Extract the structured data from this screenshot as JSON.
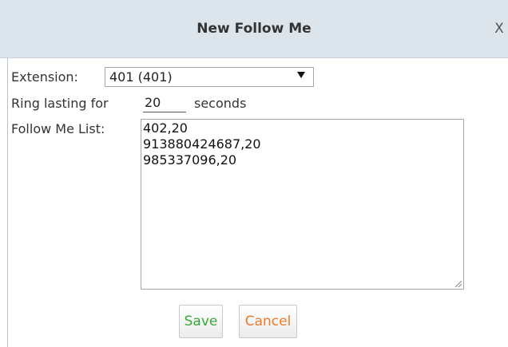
{
  "dialog": {
    "title": "New Follow Me",
    "close_label": "X"
  },
  "form": {
    "extension": {
      "label": "Extension:",
      "selected": "401 (401)"
    },
    "ring": {
      "label_before": "Ring lasting for",
      "value": "20",
      "label_after": "seconds"
    },
    "follow_me_list": {
      "label": "Follow Me List:",
      "entries": [
        "402,20",
        "913880424687,20",
        "985337096,20"
      ]
    }
  },
  "buttons": {
    "save_label": "Save",
    "cancel_label": "Cancel"
  },
  "colors": {
    "titlebar_bg": "#dce4ec",
    "save_text": "#3aa83a",
    "cancel_text": "#ec7a2c"
  },
  "icons": {
    "close": "close-icon",
    "dropdown": "chevron-down-icon",
    "resize": "resize-grip-icon"
  }
}
